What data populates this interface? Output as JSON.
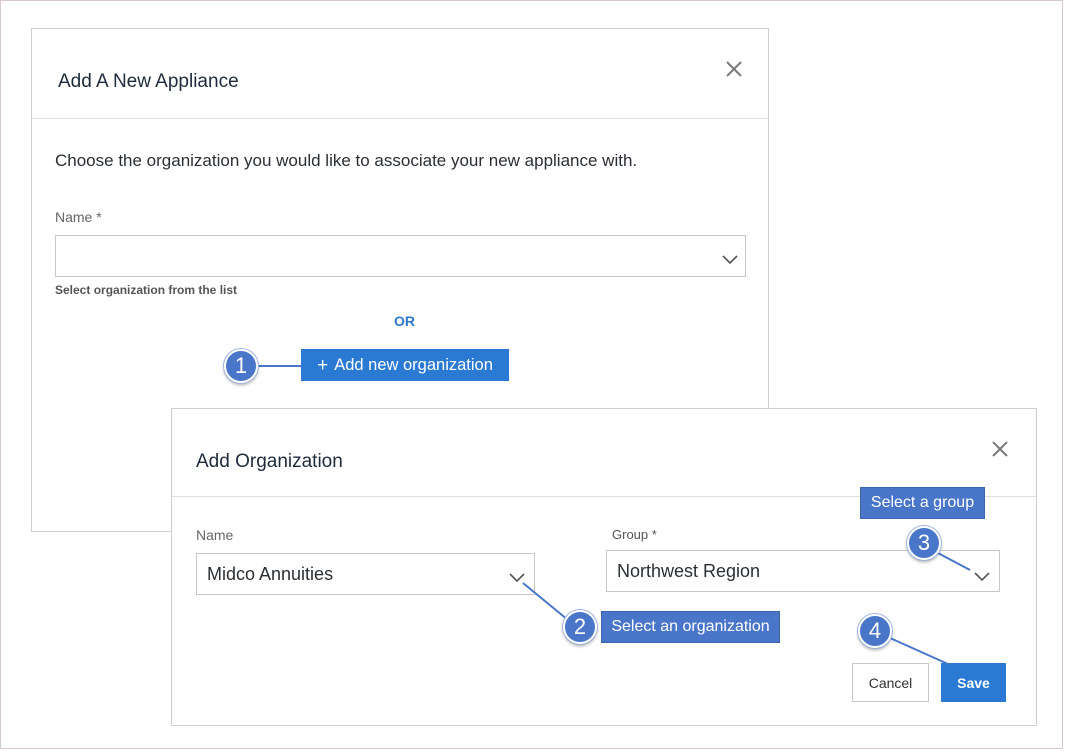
{
  "appliance_dialog": {
    "title": "Add A New Appliance",
    "intro": "Choose the organization you would like to associate your new appliance with.",
    "name_label": "Name *",
    "name_value": "",
    "helper": "Select organization from the list",
    "or_text": "OR",
    "add_org_plus": "+",
    "add_org_label": "Add new organization"
  },
  "org_dialog": {
    "title": "Add Organization",
    "name_label": "Name",
    "name_value": "Midco Annuities",
    "group_label": "Group",
    "group_required": "*",
    "group_value": "Northwest Region",
    "cancel_label": "Cancel",
    "save_label": "Save"
  },
  "callouts": {
    "step1": "1",
    "step2": "2",
    "step3": "3",
    "step4": "4",
    "select_org": "Select an organization",
    "select_group": "Select a group"
  },
  "colors": {
    "accent": "#2a79d3",
    "callout": "#4a76c9",
    "title": "#1e2b3c"
  },
  "icons": {
    "close": "close-icon",
    "dropdown": "chevron-down-icon"
  }
}
